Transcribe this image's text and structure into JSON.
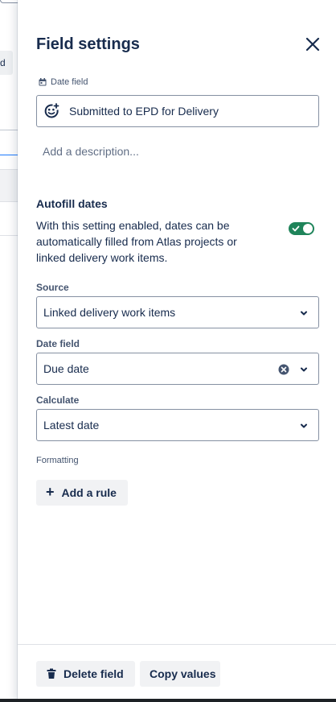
{
  "panel": {
    "title": "Field settings",
    "field_type_label": "Date field",
    "field_name": "Submitted to EPD for Delivery",
    "description_placeholder": "Add a description..."
  },
  "autofill": {
    "title": "Autofill dates",
    "description": "With this setting enabled, dates can be automatically filled from Atlas projects or linked delivery work items.",
    "enabled": true
  },
  "source": {
    "label": "Source",
    "value": "Linked delivery work items"
  },
  "date_field": {
    "label": "Date field",
    "value": "Due date"
  },
  "calculate": {
    "label": "Calculate",
    "value": "Latest date"
  },
  "formatting": {
    "label": "Formatting",
    "add_rule": "Add a rule"
  },
  "footer": {
    "delete_label": "Delete field",
    "copy_label": "Copy values"
  },
  "background": {
    "chip_text": "d"
  },
  "colors": {
    "toggle_on": "#1f845a",
    "text": "#172b4d",
    "border": "#8590a2"
  }
}
